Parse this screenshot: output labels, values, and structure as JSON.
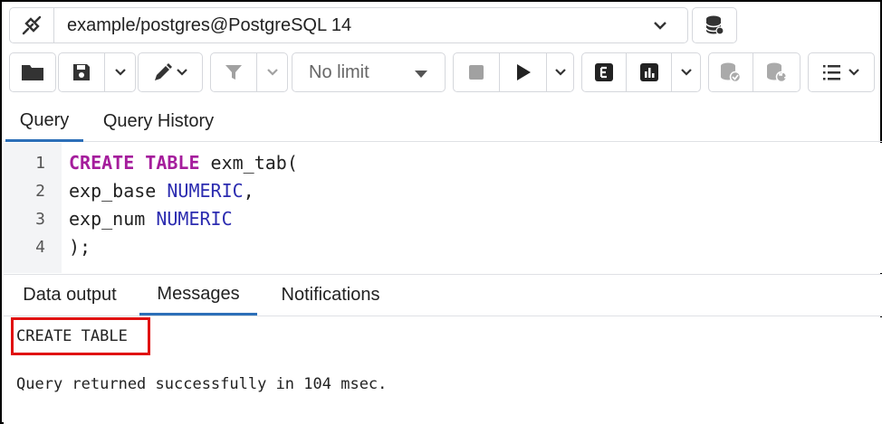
{
  "connection": {
    "label": "example/postgres@PostgreSQL 14"
  },
  "toolbar": {
    "limit_label": "No limit"
  },
  "query_tabs": [
    {
      "label": "Query",
      "active": true
    },
    {
      "label": "Query History",
      "active": false
    }
  ],
  "editor": {
    "line_numbers": [
      "1",
      "2",
      "3",
      "4"
    ],
    "lines": [
      {
        "kw": "CREATE TABLE",
        "rest": " exm_tab("
      },
      {
        "ident": "exp_base ",
        "type": "NUMERIC",
        "tail": ","
      },
      {
        "ident": "exp_num ",
        "type": "NUMERIC",
        "tail": ""
      },
      {
        "ident": ");",
        "type": "",
        "tail": ""
      }
    ]
  },
  "output_tabs": [
    {
      "label": "Data output",
      "active": false
    },
    {
      "label": "Messages",
      "active": true
    },
    {
      "label": "Notifications",
      "active": false
    }
  ],
  "output": {
    "status": "CREATE TABLE",
    "message": "Query returned successfully in 104 msec."
  },
  "colors": {
    "keyword": "#a51d9c",
    "type": "#2c2cb0",
    "active_tab": "#2c6fb8",
    "highlight": "#e01010"
  }
}
